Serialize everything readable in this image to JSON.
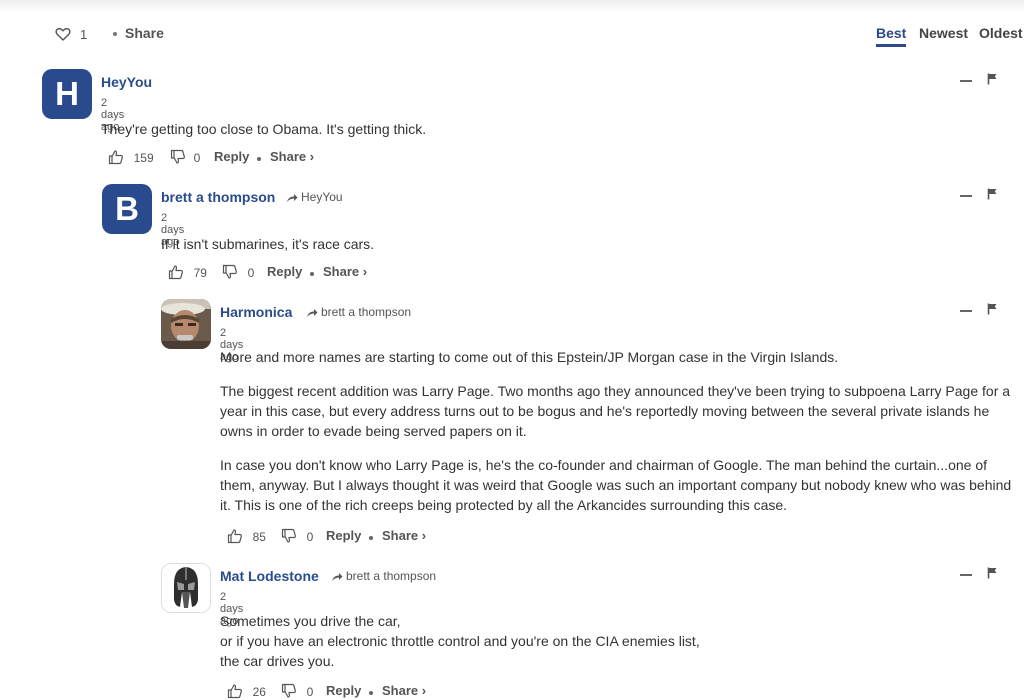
{
  "header": {
    "like_count": "1",
    "share_label": "Share",
    "sort_tabs": [
      {
        "label": "Best",
        "active": true
      },
      {
        "label": "Newest",
        "active": false
      },
      {
        "label": "Oldest",
        "active": false
      }
    ]
  },
  "comments": [
    {
      "avatar_letter": "H",
      "author": "HeyYou",
      "reply_to": "",
      "time": "2 days ago",
      "paragraphs": [
        "They're getting too close to Obama. It's getting thick."
      ],
      "upvotes": "159",
      "downvotes": "0",
      "reply_label": "Reply",
      "share_label": "Share ›"
    },
    {
      "avatar_letter": "B",
      "author": "brett a thompson",
      "reply_to": "HeyYou",
      "time": "2 days ago",
      "paragraphs": [
        "If it isn't submarines, it's race cars."
      ],
      "upvotes": "79",
      "downvotes": "0",
      "reply_label": "Reply",
      "share_label": "Share ›"
    },
    {
      "avatar_letter": "",
      "author": "Harmonica",
      "reply_to": "brett a thompson",
      "time": "2 days ago",
      "paragraphs": [
        "More and more names are starting to come out of this Epstein/JP Morgan case in the Virgin Islands.",
        "The biggest recent addition was Larry Page. Two months ago they announced they've been trying to subpoena Larry Page for a year in this case, but every address turns out to be bogus and he's reportedly moving between the several private islands he owns in order to evade being served papers on it.",
        "In case you don't know who Larry Page is, he's the co-founder and chairman of Google. The man behind the curtain...one of them, anyway. But I always thought it was weird that Google was such an important company but nobody knew who was behind it. This is one of the rich creeps being protected by all the Arkancides surrounding this case."
      ],
      "upvotes": "85",
      "downvotes": "0",
      "reply_label": "Reply",
      "share_label": "Share ›"
    },
    {
      "avatar_letter": "",
      "author": "Mat Lodestone",
      "reply_to": "brett a thompson",
      "time": "2 days ago",
      "lines": [
        "Sometimes you drive the car,",
        "or if you have an electronic throttle control and you're on the CIA enemies list,",
        "the car drives you."
      ],
      "upvotes": "26",
      "downvotes": "0",
      "reply_label": "Reply",
      "share_label": "Share ›"
    }
  ],
  "icons": {
    "heart": "heart-icon",
    "thumbs_up": "thumbs-up-icon",
    "thumbs_down": "thumbs-down-icon",
    "reply_arrow": "reply-arrow-icon",
    "collapse": "collapse-minus-icon",
    "flag": "flag-icon"
  },
  "colors": {
    "accent": "#2b4c8c",
    "avatar_bg": "#2a4a8e"
  }
}
